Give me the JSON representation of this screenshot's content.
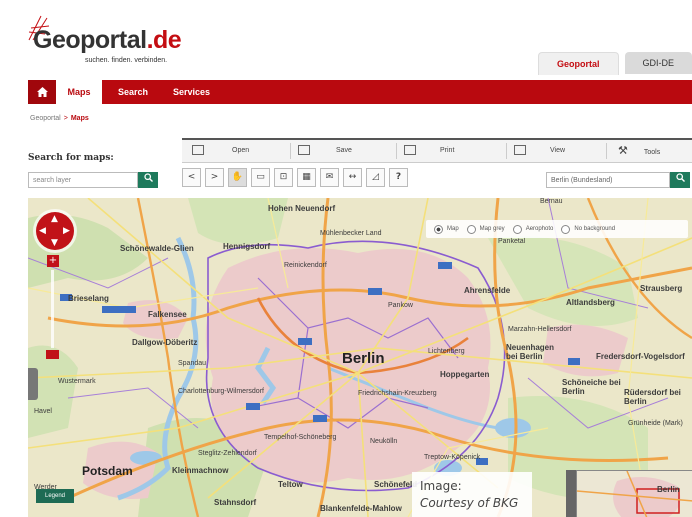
{
  "header": {
    "logo_text": "Geoportal",
    "logo_tld": ".de",
    "tagline": "suchen. finden. verbinden.",
    "tabs": [
      {
        "label": "Geoportal",
        "active": true
      },
      {
        "label": "GDI-DE",
        "active": false
      }
    ]
  },
  "nav": {
    "items": [
      {
        "label": "Maps",
        "active": true
      },
      {
        "label": "Search",
        "active": false
      },
      {
        "label": "Services",
        "active": false
      }
    ]
  },
  "breadcrumb": {
    "root": "Geoportal",
    "sep": ">",
    "current": "Maps"
  },
  "search": {
    "title": "Search for maps:",
    "placeholder": "search layer"
  },
  "toolbar": {
    "items": [
      "Open",
      "Save",
      "Print",
      "View",
      "Tools"
    ]
  },
  "iconbar": [
    "<",
    ">",
    "✋",
    "▭",
    "⊡",
    "▦",
    "✉",
    "↔",
    "◿",
    "?"
  ],
  "place_search": {
    "value": "Berlin (Bundesland)"
  },
  "layer_switch": {
    "options": [
      {
        "label": "Map",
        "selected": true
      },
      {
        "label": "Map grey",
        "selected": false
      },
      {
        "label": "Aerophoto",
        "selected": false
      },
      {
        "label": "No background",
        "selected": false
      }
    ]
  },
  "map": {
    "labels": {
      "berlin": "Berlin",
      "neuendorf": "Hohen Neuendorf",
      "hennigsdorf": "Hennigsdorf",
      "schonewalde": "Schönewalde-Glien",
      "falkensee": "Falkensee",
      "dallgow": "Dallgow-Döberitz",
      "potsdam": "Potsdam",
      "ahrensfelde": "Ahrensfelde",
      "altlandsberg": "Altlandsberg",
      "hoppegarten": "Hoppegarten",
      "neuenhagen": "Neuenhagen bei Berlin",
      "fredersdorf": "Fredersdorf-Vogelsdorf",
      "schoneiche": "Schöneiche bei Berlin",
      "rudersdorf": "Rüdersdorf bei Berlin",
      "teltow": "Teltow",
      "kleinmachnow": "Kleinmachnow",
      "stahnsdorf": "Stahnsdorf",
      "blankenfelde": "Blankenfelde-Mahlow",
      "schonefeld": "Schönefeld",
      "strausberg": "Strausberg",
      "wandlitz": "Mühlenbecker Land",
      "pankow": "Pankow",
      "spandau": "Spandau",
      "charlottenburg": "Charlottenburg-Wilmersdorf",
      "kreuzberg": "Friedrichshain-Kreuzberg",
      "tempelhof": "Tempelhof-Schöneberg",
      "neukolln": "Neukölln",
      "lichtenberg": "Lichtenberg",
      "marzahn": "Marzahn-Hellersdorf",
      "reinickendorf": "Reinickendorf",
      "treptow": "Treptow-Köpenick",
      "steglitz": "Steglitz-Zehlendorf",
      "werder": "Werder",
      "gruenheide": "Grünheide (Mark)",
      "wustermark": "Wustermark",
      "brieselang": "Brieselang",
      "panketal": "Panketal",
      "bernau": "Bernau",
      "havel": "Havel"
    },
    "legend_label": "Legend",
    "overview_label": "Berlin"
  },
  "credit": {
    "line1": "Image:",
    "line2": "Courtesy of BKG"
  },
  "colors": {
    "brand_red": "#b9090f",
    "search_green": "#1e7a5c",
    "urban_pink": "#ecc8c8",
    "water_blue": "#9ec8e8"
  }
}
